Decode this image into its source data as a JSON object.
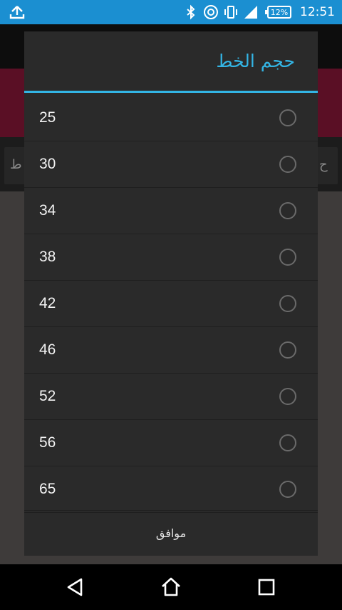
{
  "status_bar": {
    "battery": "12%",
    "time": "12:51",
    "icons": [
      "upload-icon",
      "bluetooth-icon",
      "nfc-icon",
      "vibrate-icon",
      "signal-icon",
      "battery-icon"
    ]
  },
  "background_app": {
    "left_fragment": "ط",
    "right_fragment": "ح"
  },
  "dialog": {
    "title": "حجم الخط",
    "options": [
      {
        "label": "25",
        "selected": false
      },
      {
        "label": "30",
        "selected": false
      },
      {
        "label": "34",
        "selected": false
      },
      {
        "label": "38",
        "selected": false
      },
      {
        "label": "42",
        "selected": false
      },
      {
        "label": "46",
        "selected": false
      },
      {
        "label": "52",
        "selected": false
      },
      {
        "label": "56",
        "selected": false
      },
      {
        "label": "65",
        "selected": false
      }
    ],
    "ok_label": "موافق"
  },
  "nav_bar": {
    "icons": [
      "back-icon",
      "home-icon",
      "recents-icon"
    ]
  },
  "colors": {
    "status_bar": "#1b8fd1",
    "accent": "#33b5e5",
    "dialog_bg": "#2a2a2a"
  }
}
